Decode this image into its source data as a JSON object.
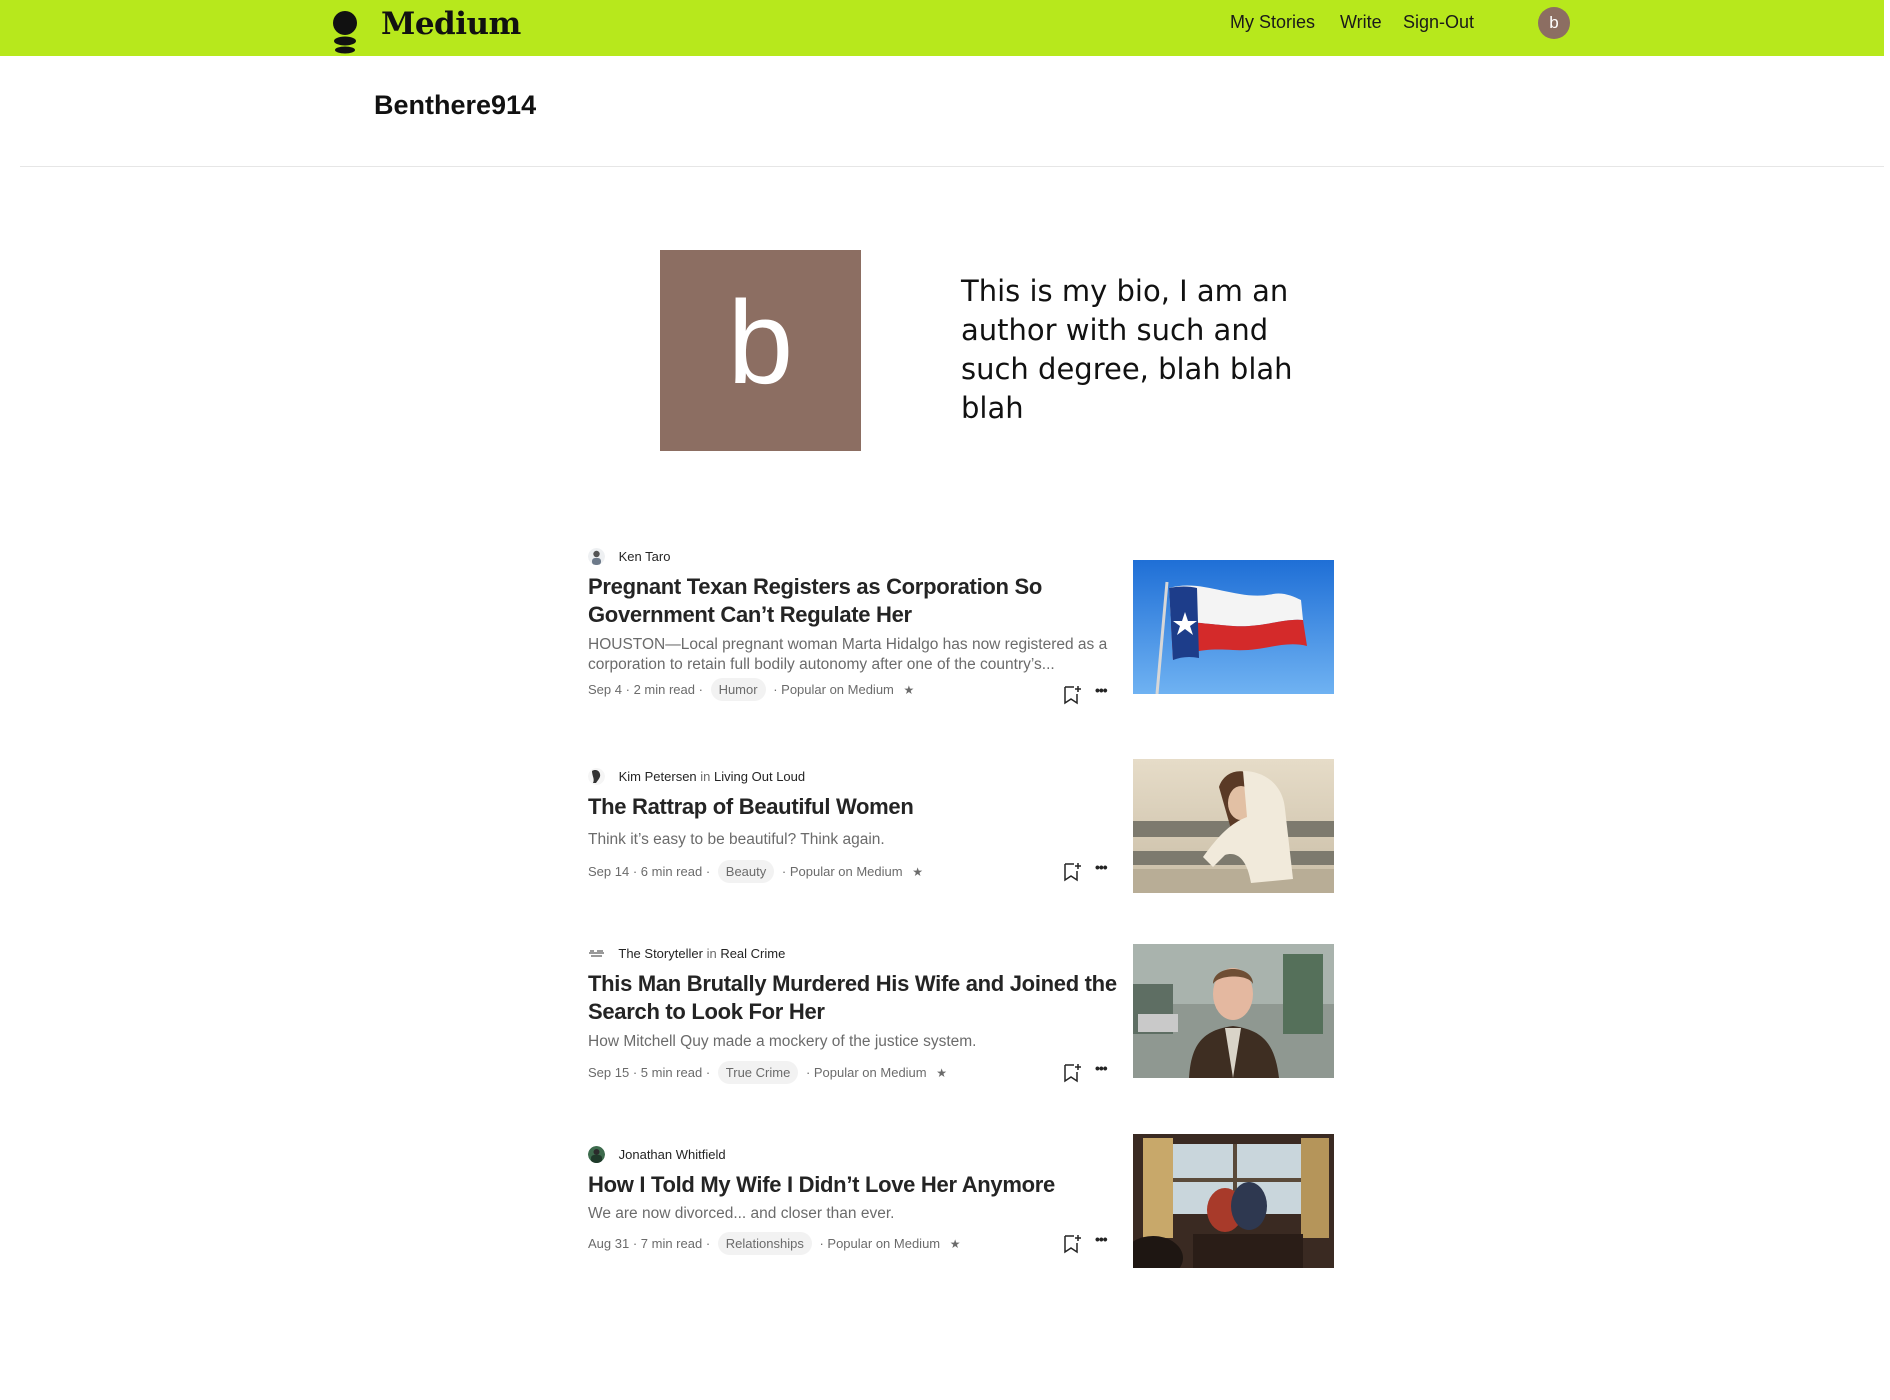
{
  "header": {
    "brand": "Medium",
    "nav": {
      "my_stories": "My Stories",
      "write": "Write",
      "sign_out": "Sign-Out"
    },
    "avatar_letter": "b",
    "accent_color": "#b7e81c"
  },
  "profile": {
    "username": "Benthere914",
    "avatar_letter": "b",
    "avatar_color": "#8c6e62",
    "bio": "This is my bio, I am an author with such and such degree, blah blah blah"
  },
  "articles": [
    {
      "author": "Ken Taro",
      "in_label": "",
      "publication": "",
      "title": "Pregnant Texan Registers as Corporation So Government Can’t Regulate Her",
      "subtitle": "HOUSTON—Local pregnant woman Marta Hidalgo has now registered as a corporation to retain full bodily autonomy after one of the country’s...",
      "date": "Sep 4",
      "read_time": "2 min read",
      "tag": "Humor",
      "popular": "Popular on Medium",
      "thumbnail": "texas-flag-image"
    },
    {
      "author": "Kim Petersen",
      "in_label": "in",
      "publication": "Living Out Loud",
      "title": "The Rattrap of Beautiful Women",
      "subtitle": "Think it’s easy to be beautiful? Think again.",
      "date": "Sep 14",
      "read_time": "6 min read",
      "tag": "Beauty",
      "popular": "Popular on Medium",
      "thumbnail": "woman-on-fence-image"
    },
    {
      "author": "The Storyteller",
      "in_label": "in",
      "publication": "Real Crime",
      "title": "This Man Brutally Murdered His Wife and Joined the Search to Look For Her",
      "subtitle": "How Mitchell Quy made a mockery of the justice system.",
      "date": "Sep 15",
      "read_time": "5 min read",
      "tag": "True Crime",
      "popular": "Popular on Medium",
      "thumbnail": "man-in-jacket-image"
    },
    {
      "author": "Jonathan Whitfield",
      "in_label": "",
      "publication": "",
      "title": "How I Told My Wife I Didn’t Love Her Anymore",
      "subtitle": "We are now divorced... and closer than ever.",
      "date": "Aug 31",
      "read_time": "7 min read",
      "tag": "Relationships",
      "popular": "Popular on Medium",
      "thumbnail": "couple-in-room-image"
    }
  ],
  "icons": {
    "bookmark": "bookmark-add-icon",
    "more": "more-options-icon",
    "star": "star-icon"
  }
}
